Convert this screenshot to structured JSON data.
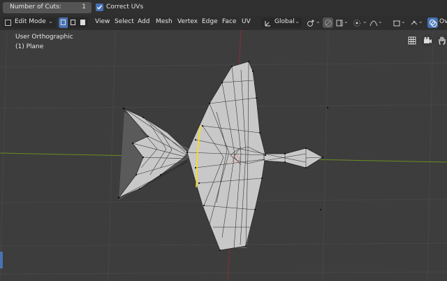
{
  "operator_panel": {
    "number_of_cuts_label": "Number of Cuts:",
    "number_of_cuts_value": "1",
    "correct_uvs_label": "Correct UVs",
    "correct_uvs_checked": true
  },
  "header": {
    "mode_label": "Edit Mode",
    "menus": [
      "View",
      "Select",
      "Add",
      "Mesh",
      "Vertex",
      "Edge",
      "Face",
      "UV"
    ],
    "orientation_label": "Global",
    "overlay_label": "Ov"
  },
  "viewport": {
    "view_name": "User Orthographic",
    "object_name": "(1) Plane"
  },
  "colors": {
    "accent": "#4772b3",
    "background": "#3d3d3d",
    "grid": "#464646",
    "x_axis": "#8b2d37",
    "y_axis": "#6b8c21",
    "mesh_face": "#c8c8c8",
    "selected_edge": "#ffe100"
  },
  "icons": {
    "select_box": "select-box-icon",
    "transform_pivot": "pivot-icon",
    "snap": "magnet-icon",
    "proportional": "proportional-edit-icon",
    "gizmo_grid": "grid-icon",
    "gizmo_camera": "camera-icon",
    "gizmo_hand": "hand-pan-icon"
  }
}
